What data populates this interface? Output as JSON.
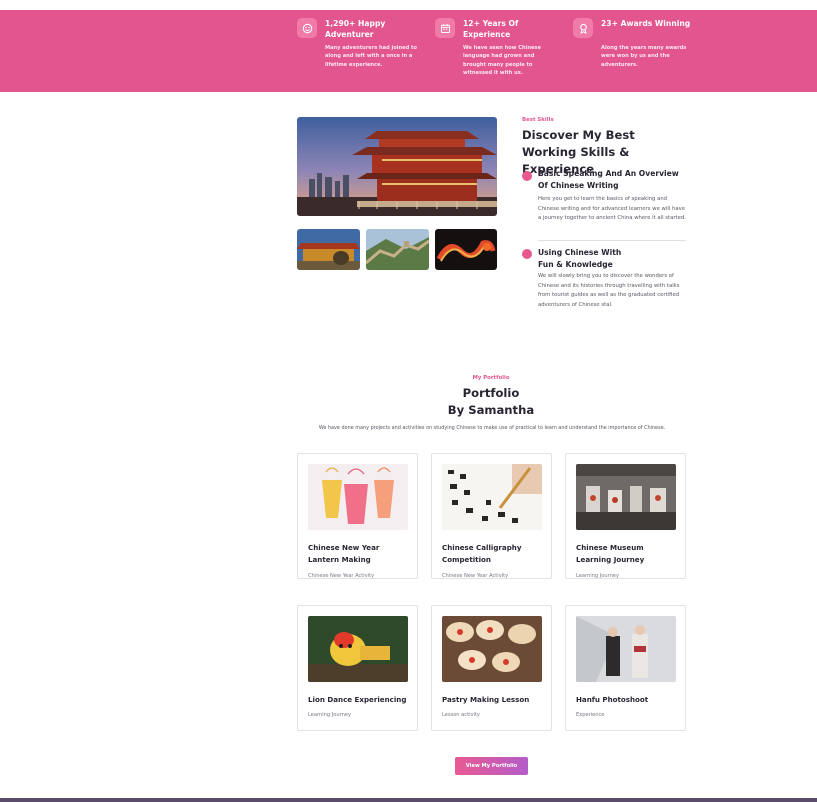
{
  "stats": [
    {
      "icon": "smile-icon",
      "title": "1,290+ Happy Adventurer",
      "desc": "Many adventurers had joined to along and left with a once in a lifetime experience."
    },
    {
      "icon": "calendar-icon",
      "title": "12+ Years Of Experience",
      "desc": "We have seen how Chinese language had grown and brought many people to witnessed it with us."
    },
    {
      "icon": "award-icon",
      "title": "23+ Awards Winning",
      "desc": "Along the years many awards were won by us and the adventurers."
    }
  ],
  "skills": {
    "eyebrow": "Best Skills",
    "heading": "Discover My Best Working Skills & Experience",
    "items": [
      {
        "title": "Basic Speaking And An Overview Of Chinese Writing",
        "desc": "Here you get to learn the basics of speaking and Chinese writing and for advanced learners we will have a journey together to ancient China where it all started."
      },
      {
        "title": "Using Chinese With Fun & Knowledge",
        "desc": "We will slowly bring you to discover the wonders of Chinese and its histories through travelling with talks from tourist guides as well as the graduated certified adventurers of Chinese stal."
      }
    ]
  },
  "portfolio": {
    "eyebrow": "My Portfolio",
    "heading_line1": "Portfolio",
    "heading_line2": "By Samantha",
    "intro": "We have done many projects and activities on studying Chinese to make use of practical to learn and understand the importance of Chinese.",
    "cards": [
      {
        "title": "Chinese New Year Lantern Making",
        "subtitle": "Chinese New Year Activity"
      },
      {
        "title": "Chinese Calligraphy Competition",
        "subtitle": "Chinese New Year Activity"
      },
      {
        "title": "Chinese Museum Learning Journey",
        "subtitle": "Learning Journey"
      },
      {
        "title": "Lion Dance Experiencing",
        "subtitle": "Learning Journey"
      },
      {
        "title": "Pastry Making Lesson",
        "subtitle": "Lesson activity"
      },
      {
        "title": "Hanfu Photoshoot",
        "subtitle": "Experience"
      }
    ],
    "button": "View My Portfolio"
  },
  "colors": {
    "accent": "#e2558f",
    "text": "#2b2533",
    "button_end": "#b45cc9"
  }
}
